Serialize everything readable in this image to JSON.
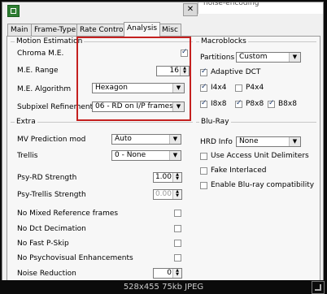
{
  "background_window": {
    "title_fragment": "noise-encoding"
  },
  "tabs": [
    "Main",
    "Frame-Type",
    "Rate Control",
    "Analysis",
    "Misc"
  ],
  "motion_estimation": {
    "title": "Motion Estimation",
    "chroma_me_label": "Chroma M.E.",
    "chroma_me_checked": true,
    "me_range_label": "M.E. Range",
    "me_range_value": "16",
    "me_algorithm_label": "M.E. Algorithm",
    "me_algorithm_value": "Hexagon",
    "subpixel_label": "Subpixel Refinement",
    "subpixel_value": "06 - RD on I/P frames"
  },
  "macroblocks": {
    "title": "Macroblocks",
    "partitions_label": "Partitions",
    "partitions_value": "Custom",
    "adaptive_dct_label": "Adaptive DCT",
    "i4x4_label": "I4x4",
    "p4x4_label": "P4x4",
    "i8x8_label": "I8x8",
    "p8x8_label": "P8x8",
    "b8x8_label": "B8x8"
  },
  "extra": {
    "title": "Extra",
    "mv_prediction_label": "MV  Prediction mod",
    "mv_prediction_value": "Auto",
    "trellis_label": "Trellis",
    "trellis_value": "0 - None",
    "psy_rd_label": "Psy-RD Strength",
    "psy_rd_value": "1.00",
    "psy_trellis_label": "Psy-Trellis Strength",
    "psy_trellis_value": "0.00",
    "no_mixed_refs_label": "No Mixed Reference frames",
    "no_dct_decimation_label": "No Dct Decimation",
    "no_fast_pskip_label": "No Fast P-Skip",
    "no_psy_enh_label": "No Psychovisual Enhancements",
    "noise_reduction_label": "Noise Reduction",
    "noise_reduction_value": "0"
  },
  "bluray": {
    "title": "Blu-Ray",
    "hrd_info_label": "HRD Info",
    "hrd_info_value": "None",
    "aud_label": "Use Access Unit Delimiters",
    "fake_interlaced_label": "Fake Interlaced",
    "bluray_compat_label": "Enable Blu-ray compatibility"
  },
  "status_text": "528x455 75kb JPEG",
  "colors": {
    "highlight_box": "#c4201f",
    "window_bg": "#f0f0f0",
    "frame_bg": "#0b0b0b"
  }
}
